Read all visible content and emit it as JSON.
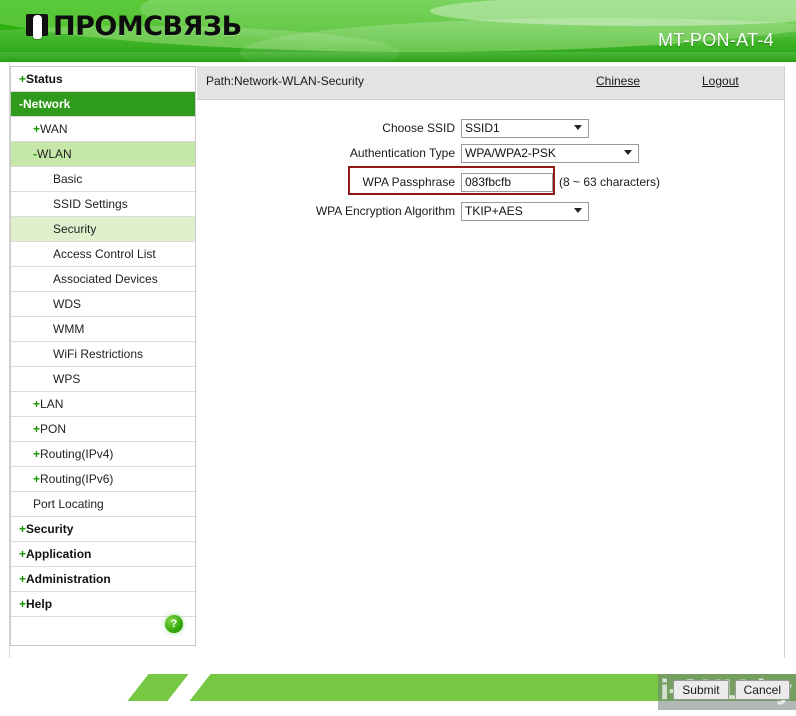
{
  "header": {
    "logo_text": "ПРОМСВЯЗЬ",
    "logo_icon": "usb-flash-drive-icon",
    "model": "MT-PON-AT-4",
    "brand_green": "#2eb410",
    "model_color": "#ffffff"
  },
  "sidebar": {
    "help_icon_label": "?",
    "items": [
      {
        "sign": "+",
        "label": "Status",
        "level": 0,
        "state": "collapsed"
      },
      {
        "sign": "-",
        "label": "Network",
        "level": 0,
        "state": "active"
      },
      {
        "sign": "+",
        "label": "WAN",
        "level": 1,
        "state": "collapsed"
      },
      {
        "sign": "-",
        "label": "WLAN",
        "level": 1,
        "state": "open"
      },
      {
        "sign": "",
        "label": "Basic",
        "level": 2,
        "state": "normal"
      },
      {
        "sign": "",
        "label": "SSID Settings",
        "level": 2,
        "state": "normal"
      },
      {
        "sign": "",
        "label": "Security",
        "level": 2,
        "state": "selected"
      },
      {
        "sign": "",
        "label": "Access Control List",
        "level": 2,
        "state": "normal"
      },
      {
        "sign": "",
        "label": "Associated Devices",
        "level": 2,
        "state": "normal"
      },
      {
        "sign": "",
        "label": "WDS",
        "level": 2,
        "state": "normal"
      },
      {
        "sign": "",
        "label": "WMM",
        "level": 2,
        "state": "normal"
      },
      {
        "sign": "",
        "label": "WiFi Restrictions",
        "level": 2,
        "state": "normal"
      },
      {
        "sign": "",
        "label": "WPS",
        "level": 2,
        "state": "normal"
      },
      {
        "sign": "+",
        "label": "LAN",
        "level": 1,
        "state": "collapsed"
      },
      {
        "sign": "+",
        "label": "PON",
        "level": 1,
        "state": "collapsed"
      },
      {
        "sign": "+",
        "label": "Routing(IPv4)",
        "level": 1,
        "state": "collapsed"
      },
      {
        "sign": "+",
        "label": "Routing(IPv6)",
        "level": 1,
        "state": "collapsed"
      },
      {
        "sign": "",
        "label": "Port Locating",
        "level": 1,
        "state": "normal"
      },
      {
        "sign": "+",
        "label": "Security",
        "level": 0,
        "state": "collapsed"
      },
      {
        "sign": "+",
        "label": "Application",
        "level": 0,
        "state": "collapsed"
      },
      {
        "sign": "+",
        "label": "Administration",
        "level": 0,
        "state": "collapsed"
      },
      {
        "sign": "+",
        "label": "Help",
        "level": 0,
        "state": "collapsed"
      }
    ]
  },
  "topbar": {
    "path": "Path:Network-WLAN-Security",
    "language_link": "Chinese",
    "logout_link": "Logout"
  },
  "form": {
    "choose_ssid": {
      "label": "Choose SSID",
      "value": "SSID1",
      "options": [
        "SSID1"
      ]
    },
    "auth_type": {
      "label": "Authentication Type",
      "value": "WPA/WPA2-PSK",
      "options": [
        "WPA/WPA2-PSK"
      ]
    },
    "wpa_passphrase": {
      "label": "WPA Passphrase",
      "value": "083fbcfb",
      "hint": "(8 ~ 63 characters)",
      "highlight_color": "#8d1a13"
    },
    "wpa_encryption": {
      "label": "WPA Encryption Algorithm",
      "value": "TKIP+AES",
      "options": [
        "TKIP+AES"
      ]
    }
  },
  "footer": {
    "submit_label": "Submit",
    "cancel_label": "Cancel",
    "watermark_text": "i-ONLI.by",
    "bar_color": "#76c843"
  }
}
